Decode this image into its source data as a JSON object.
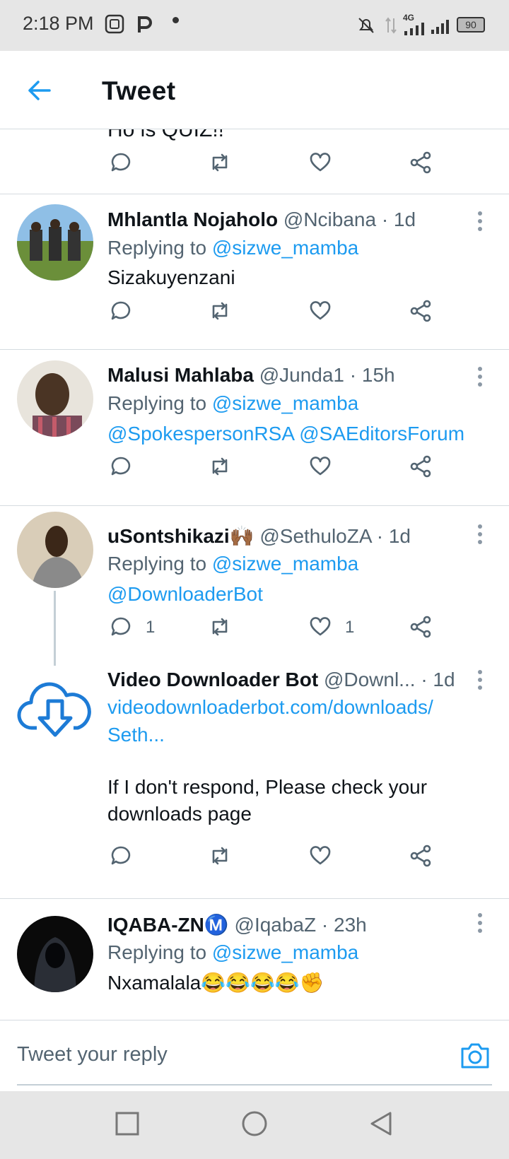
{
  "status_bar": {
    "time": "2:18 PM",
    "notif_icons": [
      "app-icon",
      "p-icon",
      "dot-icon"
    ],
    "system_icons": [
      "mute-icon",
      "data-arrows-icon",
      "4g-signal-icon",
      "signal-icon"
    ],
    "network": "4G",
    "battery": "90"
  },
  "header": {
    "title": "Tweet",
    "back_icon": "back-arrow-icon"
  },
  "colors": {
    "accent": "#1d9bf0",
    "text": "#0f1419",
    "muted": "#536471",
    "divider": "#d5dbe0"
  },
  "cut_off_text": "Ho is QUIZ!!",
  "tweets": [
    {
      "name": "Mhlantla Nojaholo",
      "handle": "@Ncibana",
      "time": "· 1d",
      "replying_label": "Replying to",
      "replying_to": "@sizwe_mamba",
      "text": "Sizakuyenzani"
    },
    {
      "name": "Malusi Mahlaba",
      "handle": "@Junda1",
      "time": "· 15h",
      "replying_label": "Replying to",
      "replying_to": "@sizwe_mamba",
      "mentions": "@SpokespersonRSA @SAEditorsForum"
    },
    {
      "name": "uSontshikazi🙌🏾",
      "handle": "@SethuloZA",
      "time": "· 1d",
      "replying_label": "Replying to",
      "replying_to": "@sizwe_mamba",
      "mentions": "@DownloaderBot",
      "reply_count": "1",
      "like_count": "1"
    },
    {
      "name": "Video Downloader Bot",
      "handle": "@Downl...",
      "time": "· 1d",
      "link_line1": "videodownloaderbot.com/downloads/",
      "link_line2": "Seth...",
      "text_line1": "If I don't respond, Please check your",
      "text_line2": "downloads page"
    },
    {
      "name": "IQABA-ZNⓂ️",
      "handle": "@IqabaZ",
      "time": "· 23h",
      "replying_label": "Replying to",
      "replying_to": "@sizwe_mamba",
      "text": "Nxamalala😂😂😂😂✊"
    }
  ],
  "reply_bar": {
    "placeholder": "Tweet your reply",
    "camera_icon": "camera-icon"
  },
  "nav_bar": {
    "icons": [
      "recents-square-icon",
      "home-circle-icon",
      "back-triangle-icon"
    ]
  }
}
